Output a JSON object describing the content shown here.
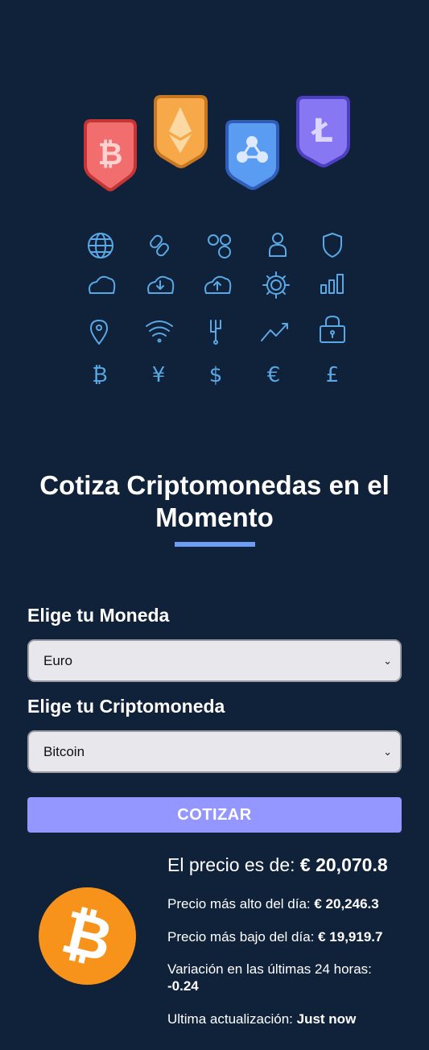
{
  "page": {
    "title": "Cotiza Criptomonedas en el Momento",
    "colors": {
      "background": "#10213a",
      "accent": "#6d9cf7",
      "button": "#9497ff",
      "icon_stroke": "#5aa9e6",
      "coin": "#f7931a"
    }
  },
  "hero": {
    "badges": [
      "bitcoin-badge-icon",
      "ethereum-badge-icon",
      "ripple-badge-icon",
      "litecoin-badge-icon"
    ],
    "icons": [
      "globe-icon",
      "link-icon",
      "network-icon",
      "user-icon",
      "shield-icon",
      "cloud-icon",
      "cloud-download-icon",
      "cloud-upload-icon",
      "gear-icon",
      "bar-chart-icon",
      "location-pin-icon",
      "wifi-icon",
      "circuit-icon",
      "trend-up-icon",
      "lock-icon",
      "bitcoin-symbol-icon",
      "yen-symbol-icon",
      "dollar-symbol-icon",
      "euro-symbol-icon",
      "pound-symbol-icon"
    ]
  },
  "form": {
    "currency_label": "Elige tu Moneda",
    "currency_value": "Euro",
    "crypto_label": "Elige tu Criptomoneda",
    "crypto_value": "Bitcoin",
    "submit_label": "COTIZAR"
  },
  "result": {
    "price_label": "El precio es de: ",
    "price_value": "€ 20,070.8",
    "high_label": "Precio más alto del día: ",
    "high_value": "€ 20,246.3",
    "low_label": "Precio más bajo del día: ",
    "low_value": "€ 19,919.7",
    "change_label": "Variación en las últimas 24 horas: ",
    "change_value": "-0.24",
    "updated_label": "Ultima actualización: ",
    "updated_value": "Just now",
    "coin_icon": "bitcoin-logo-icon"
  }
}
